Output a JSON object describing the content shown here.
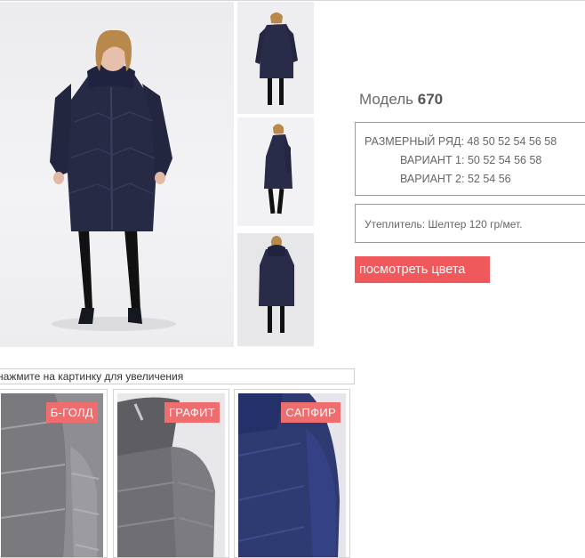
{
  "model": {
    "label": "Модель",
    "number": "670"
  },
  "sizes": {
    "line1": "РАЗМЕРНЫЙ РЯД: 48 50 52 54 56 58",
    "line2": "ВАРИАНТ 1: 50 52 54 56 58",
    "line3": "ВАРИАНТ 2: 52 54 56"
  },
  "filling": "Утеплитель: Шелтер 120 гр/мет.",
  "view_colors_button": "посмотреть цвета",
  "hint": "нажмите на картинку для увеличения",
  "swatches": [
    {
      "label": "Б-ГОЛД",
      "color": "#8e8e92"
    },
    {
      "label": "ГРАФИТ",
      "color": "#6f6f73"
    },
    {
      "label": "САПФИР",
      "color": "#2e3a72"
    }
  ],
  "colors": {
    "accent": "#f0595c",
    "badge": "#ee6d6f",
    "coat": "#262a45"
  }
}
